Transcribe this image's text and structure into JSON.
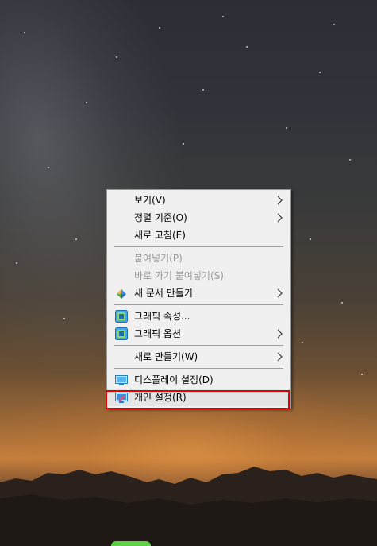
{
  "menu": {
    "items": [
      {
        "label": "보기(V)",
        "submenu": true,
        "enabled": true
      },
      {
        "label": "정렬 기준(O)",
        "submenu": true,
        "enabled": true
      },
      {
        "label": "새로 고침(E)",
        "submenu": false,
        "enabled": true
      },
      {
        "label": "붙여넣기(P)",
        "submenu": false,
        "enabled": false
      },
      {
        "label": "바로 가기 붙여넣기(S)",
        "submenu": false,
        "enabled": false
      },
      {
        "label": "새 문서 만들기",
        "submenu": true,
        "enabled": true,
        "icon": "new-document-icon"
      },
      {
        "label": "그래픽 속성...",
        "submenu": false,
        "enabled": true,
        "icon": "intel-graphics-icon"
      },
      {
        "label": "그래픽 옵션",
        "submenu": true,
        "enabled": true,
        "icon": "intel-graphics-icon"
      },
      {
        "label": "새로 만들기(W)",
        "submenu": true,
        "enabled": true
      },
      {
        "label": "디스플레이 설정(D)",
        "submenu": false,
        "enabled": true,
        "icon": "display-icon"
      },
      {
        "label": "개인 설정(R)",
        "submenu": false,
        "enabled": true,
        "icon": "personalize-icon",
        "highlighted": true
      }
    ]
  },
  "colors": {
    "menu_background": "#f0f0f0",
    "highlight_border": "#e00000",
    "disabled_text": "#9a9a9a"
  }
}
